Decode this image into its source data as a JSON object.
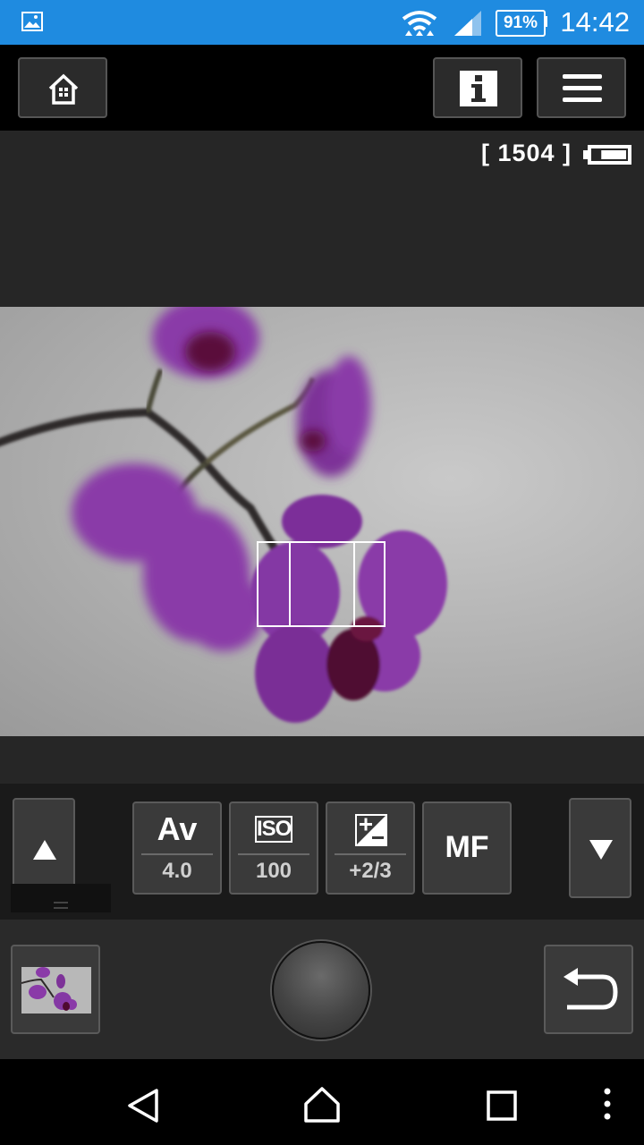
{
  "status_bar": {
    "time": "14:42",
    "battery_percent": "91%",
    "icons": [
      "gallery-notification-icon",
      "wifi-icon",
      "cell-signal-icon",
      "battery-icon"
    ]
  },
  "toolbar": {
    "icons": [
      "home-icon",
      "info-icon",
      "menu-icon"
    ]
  },
  "camera_info": {
    "shots_remaining": "[ 1504 ]",
    "battery_level": 0.75
  },
  "controls": {
    "mode_label": "Av",
    "aperture": "4.0",
    "iso_label": "ISO",
    "iso": "100",
    "exposure_comp": "+2/3",
    "focus_mode": "MF",
    "icons": [
      "scroll-up-icon",
      "exposure-compensation-icon",
      "scroll-down-icon",
      "back-arrow-icon"
    ]
  },
  "colors": {
    "status_bar": "#1f8be0",
    "button_bg": "#3a3a3a",
    "orchid": "#8a3aa8"
  },
  "nav": {
    "icons": [
      "nav-back-icon",
      "nav-home-icon",
      "nav-recents-icon",
      "nav-more-icon"
    ]
  }
}
